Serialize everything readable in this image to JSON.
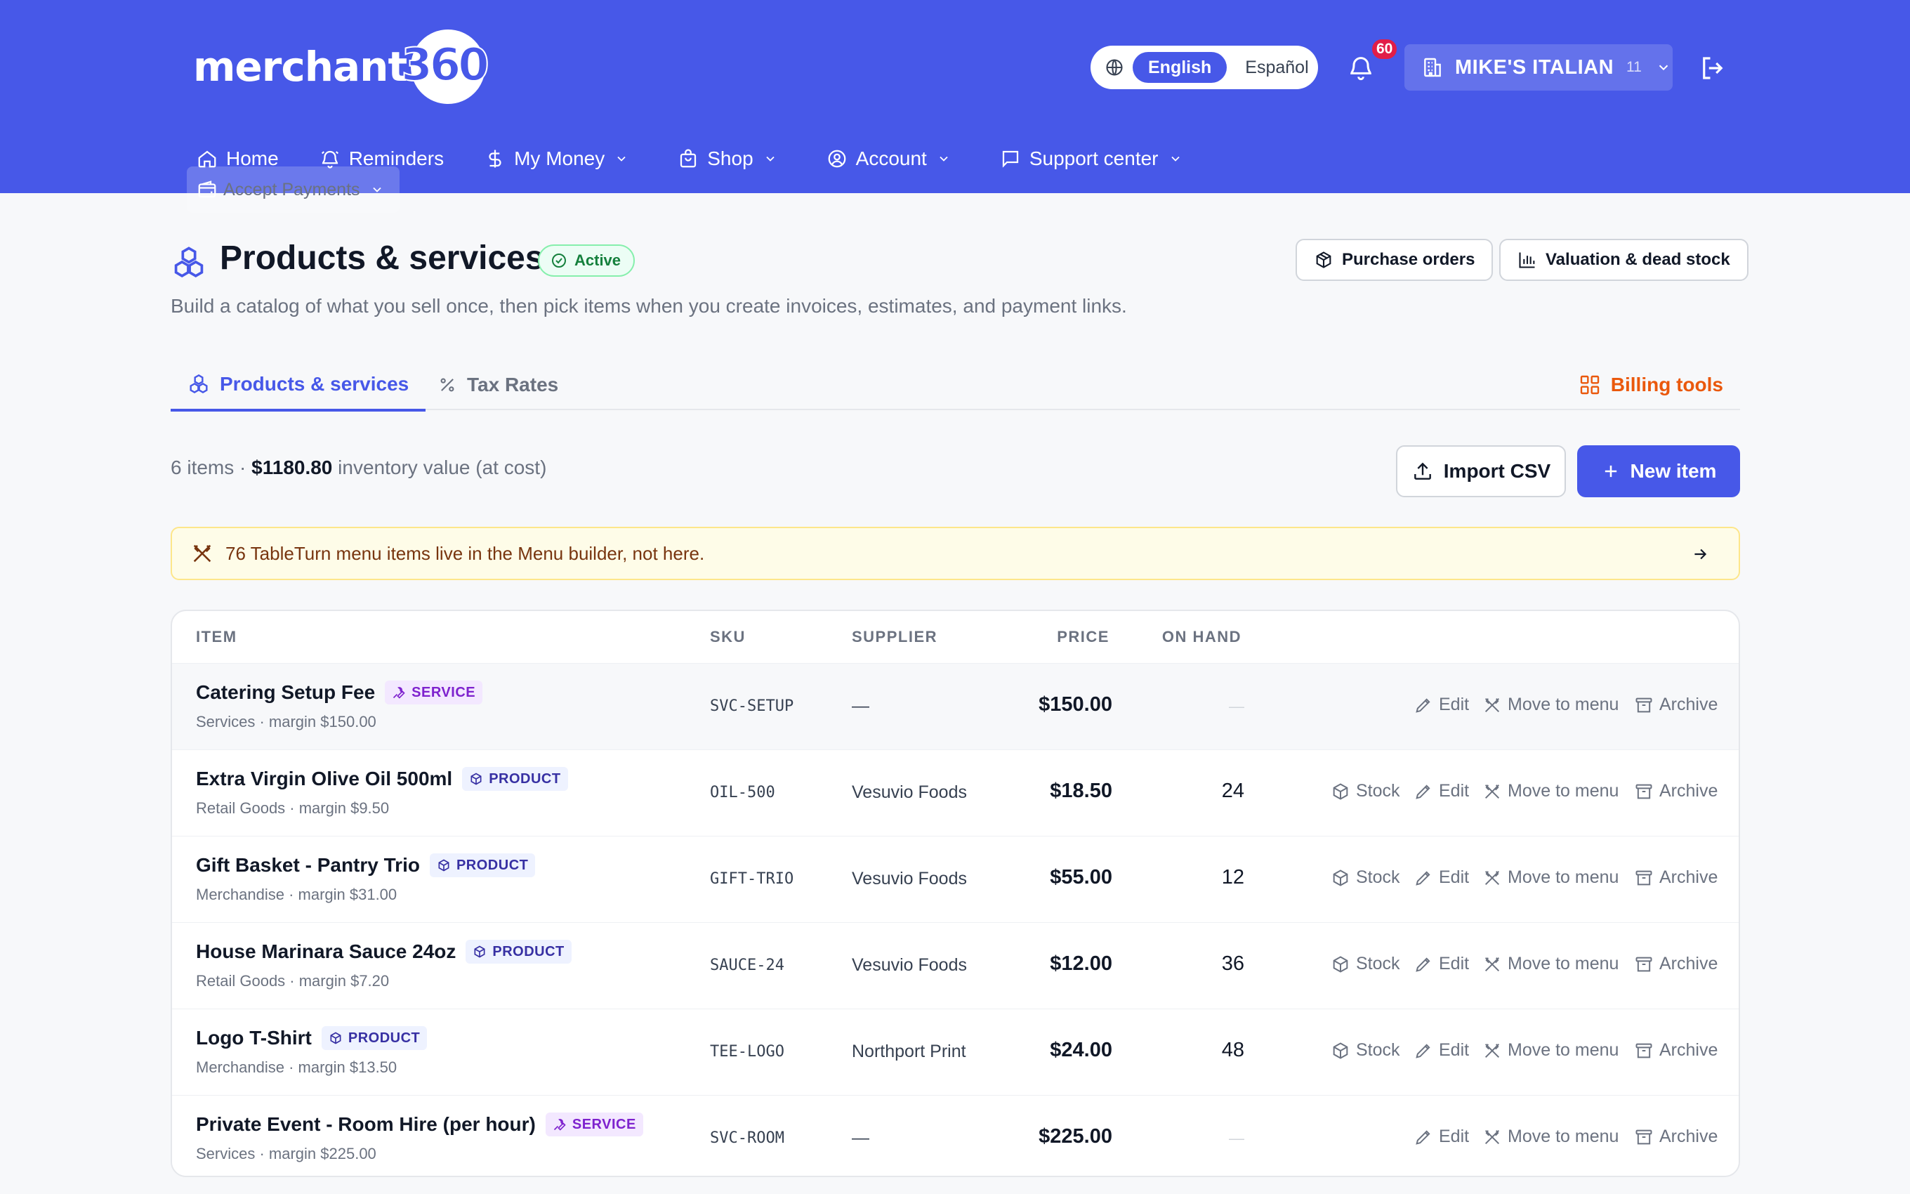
{
  "header": {
    "logo_text": "merchant",
    "logo_num": "360",
    "lang_active": "English",
    "lang_other": "Español",
    "notif_count": "60",
    "account_name": "MIKE'S ITALIAN",
    "account_count": "11"
  },
  "nav": [
    {
      "label": "Home"
    },
    {
      "label": "Reminders"
    },
    {
      "label": "My Money"
    },
    {
      "label": "Accept Payments"
    },
    {
      "label": "Shop"
    },
    {
      "label": "Account"
    },
    {
      "label": "Support center"
    }
  ],
  "page": {
    "title": "Products & services",
    "status": "Active",
    "subtitle": "Build a catalog of what you sell once, then pick items when you create invoices, estimates, and payment links.",
    "btn_purchase": "Purchase orders",
    "btn_valuation": "Valuation & dead stock"
  },
  "tabs": {
    "products": "Products & services",
    "tax": "Tax Rates",
    "billing": "Billing tools"
  },
  "summary": {
    "count": "6 items · ",
    "value": "$1180.80",
    "suffix": " inventory value (at cost)"
  },
  "buttons": {
    "import": "Import CSV",
    "new": "New item"
  },
  "banner": "76 TableTurn menu items live in the Menu builder, not here.",
  "table": {
    "headers": {
      "item": "ITEM",
      "sku": "SKU",
      "supplier": "SUPPLIER",
      "price": "PRICE",
      "onhand": "ON HAND"
    },
    "actions": {
      "stock": "Stock",
      "edit": "Edit",
      "move": "Move to menu",
      "archive": "Archive"
    },
    "rows": [
      {
        "name": "Catering Setup Fee",
        "tag": "SERVICE",
        "meta": "Services · margin $150.00",
        "sku": "SVC-SETUP",
        "supplier": "—",
        "price": "$150.00",
        "onhand": "—"
      },
      {
        "name": "Extra Virgin Olive Oil 500ml",
        "tag": "PRODUCT",
        "meta": "Retail Goods · margin $9.50",
        "sku": "OIL-500",
        "supplier": "Vesuvio Foods",
        "price": "$18.50",
        "onhand": "24"
      },
      {
        "name": "Gift Basket - Pantry Trio",
        "tag": "PRODUCT",
        "meta": "Merchandise · margin $31.00",
        "sku": "GIFT-TRIO",
        "supplier": "Vesuvio Foods",
        "price": "$55.00",
        "onhand": "12"
      },
      {
        "name": "House Marinara Sauce 24oz",
        "tag": "PRODUCT",
        "meta": "Retail Goods · margin $7.20",
        "sku": "SAUCE-24",
        "supplier": "Vesuvio Foods",
        "price": "$12.00",
        "onhand": "36"
      },
      {
        "name": "Logo T-Shirt",
        "tag": "PRODUCT",
        "meta": "Merchandise · margin $13.50",
        "sku": "TEE-LOGO",
        "supplier": "Northport Print",
        "price": "$24.00",
        "onhand": "48"
      },
      {
        "name": "Private Event - Room Hire (per hour)",
        "tag": "SERVICE",
        "meta": "Services · margin $225.00",
        "sku": "SVC-ROOM",
        "supplier": "—",
        "price": "$225.00",
        "onhand": "—"
      }
    ]
  },
  "colors": {
    "brand": "#4758e8",
    "billing": "#ea580c",
    "active": "#15803d",
    "badge": "#e11d48"
  }
}
